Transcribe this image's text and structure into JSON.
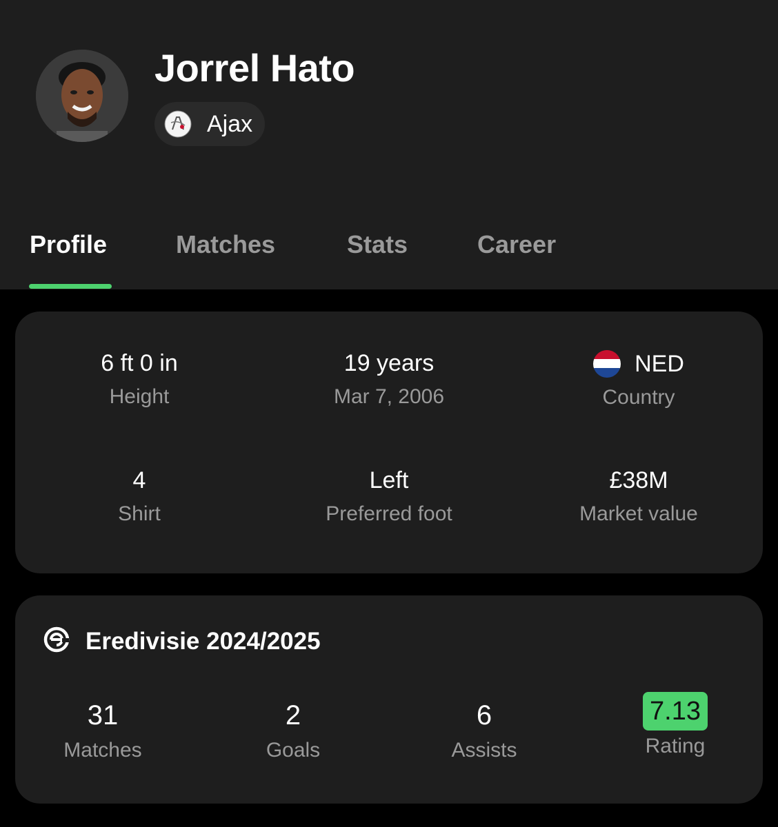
{
  "player": {
    "name": "Jorrel Hato",
    "club": "Ajax"
  },
  "tabs": [
    {
      "label": "Profile",
      "active": true
    },
    {
      "label": "Matches",
      "active": false
    },
    {
      "label": "Stats",
      "active": false
    },
    {
      "label": "Career",
      "active": false
    }
  ],
  "info": {
    "height": {
      "value": "6 ft 0 in",
      "label": "Height"
    },
    "age": {
      "value": "19 years",
      "label": "Mar 7, 2006"
    },
    "country": {
      "value": "NED",
      "label": "Country"
    },
    "shirt": {
      "value": "4",
      "label": "Shirt"
    },
    "foot": {
      "value": "Left",
      "label": "Preferred foot"
    },
    "market": {
      "value": "£38M",
      "label": "Market value"
    }
  },
  "season": {
    "title": "Eredivisie 2024/2025",
    "stats": [
      {
        "value": "31",
        "label": "Matches"
      },
      {
        "value": "2",
        "label": "Goals"
      },
      {
        "value": "6",
        "label": "Assists"
      },
      {
        "value": "7.13",
        "label": "Rating"
      }
    ]
  },
  "colors": {
    "accent": "#4dd26e",
    "card": "#1e1e1e",
    "muted": "#9a9a9a",
    "background": "#000000"
  },
  "icons": {
    "club_logo": "ajax-logo",
    "flag": "netherlands-flag",
    "league": "eredivisie-logo"
  }
}
